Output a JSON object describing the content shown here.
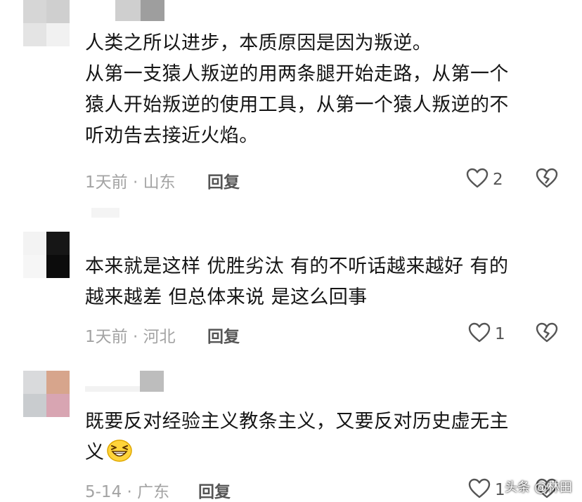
{
  "comments": [
    {
      "lines": [
        "人类之所以进步，本质原因是因为叛逆。",
        "从第一支猿人叛逆的用两条腿开始走路，从第一个",
        "猿人开始叛逆的使用工具，从第一个猿人叛逆的不",
        "听劝告去接近火焰。"
      ],
      "time": "1天前",
      "location": "山东",
      "reply_label": "回复",
      "like_count": "2"
    },
    {
      "lines": [
        "本来就是这样 优胜劣汰 有的不听话越来越好 有的",
        "越来越差 但总体来说 是这么回事"
      ],
      "time": "1天前",
      "location": "河北",
      "reply_label": "回复",
      "like_count": "1"
    },
    {
      "lines": [
        "既要反对经验主义教条主义，又要反对历史虚无主",
        "义"
      ],
      "emoji": "grinning-face-emoji",
      "time": "5-14",
      "location": "广东",
      "reply_label": "回复",
      "like_count": "1"
    }
  ],
  "separator": "·",
  "watermark": "头条 @林田",
  "icons": {
    "like": "heart-outline-icon",
    "dislike": "broken-heart-icon"
  },
  "colors": {
    "text": "#151515",
    "meta": "#a3a3a3",
    "reply": "#555555"
  }
}
